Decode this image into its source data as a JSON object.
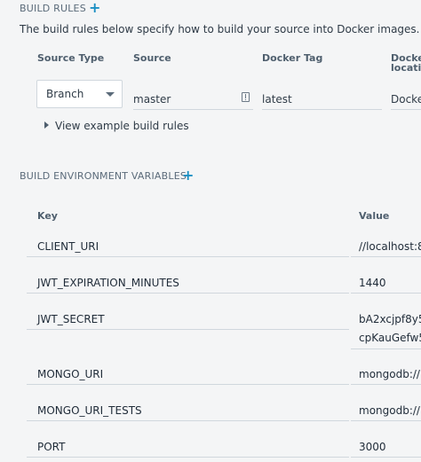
{
  "build_rules": {
    "title": "BUILD RULES",
    "description": "The build rules below specify how to build your source into Docker images.",
    "columns": {
      "source_type": "Source Type",
      "source": "Source",
      "docker_tag": "Docker Tag",
      "docker_location_line1": "Docke",
      "docker_location_line2": "locatio"
    },
    "row": {
      "source_type_value": "Branch",
      "source_value": "master",
      "docker_tag_value": "latest",
      "docker_location_value": "Docke"
    },
    "example_link": "View example build rules"
  },
  "env": {
    "title": "BUILD ENVIRONMENT VARIABLES",
    "headers": {
      "key": "Key",
      "value": "Value"
    },
    "rows": [
      {
        "key": "CLIENT_URI",
        "value": "//localhost:8"
      },
      {
        "key": "JWT_EXPIRATION_MINUTES",
        "value": "1440"
      },
      {
        "key": "JWT_SECRET",
        "value": "bA2xcjpf8y5",
        "value2": "cpKauGefw5"
      },
      {
        "key": "MONGO_URI",
        "value": "mongodb://m"
      },
      {
        "key": "MONGO_URI_TESTS",
        "value": "mongodb://m"
      },
      {
        "key": "PORT",
        "value": "3000"
      }
    ]
  },
  "colors": {
    "accent": "#1b8fc3",
    "background": "#f4f5f6"
  }
}
